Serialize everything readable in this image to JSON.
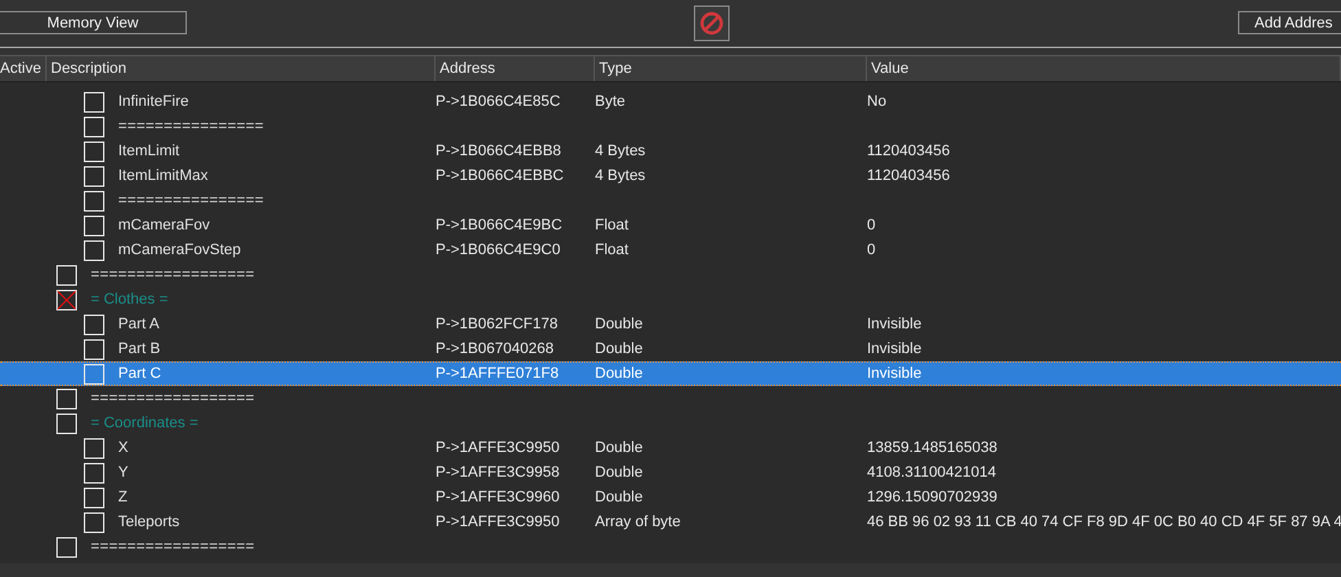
{
  "toolbar": {
    "memory_view_button": "Memory View",
    "add_address_button": "Add Addres"
  },
  "table": {
    "columns": [
      "Active",
      "Description",
      "Address",
      "Type",
      "Value"
    ],
    "rows": [
      {
        "kind": "continuation",
        "children": [
          {
            "kind": "entry",
            "description": "InfiniteFire",
            "address": "P->1B066C4E85C",
            "type": "Byte",
            "value": "No",
            "checked": false,
            "selected": false
          },
          {
            "kind": "separator",
            "description": "================",
            "checked": false,
            "selected": false
          },
          {
            "kind": "entry",
            "description": "ItemLimit",
            "address": "P->1B066C4EBB8",
            "type": "4 Bytes",
            "value": "1120403456",
            "checked": false,
            "selected": false
          },
          {
            "kind": "entry",
            "description": "ItemLimitMax",
            "address": "P->1B066C4EBBC",
            "type": "4 Bytes",
            "value": "1120403456",
            "checked": false,
            "selected": false
          },
          {
            "kind": "separator",
            "description": "================",
            "checked": false,
            "selected": false
          },
          {
            "kind": "entry",
            "description": "mCameraFov",
            "address": "P->1B066C4E9BC",
            "type": "Float",
            "value": "0",
            "checked": false,
            "selected": false
          },
          {
            "kind": "entry",
            "description": "mCameraFovStep",
            "address": "P->1B066C4E9C0",
            "type": "Float",
            "value": "0",
            "checked": false,
            "selected": false
          }
        ]
      },
      {
        "kind": "separator",
        "description": "==================",
        "checked": false,
        "selected": false
      },
      {
        "kind": "group",
        "description": "= Clothes =",
        "checked": true,
        "selected": false,
        "children": [
          {
            "kind": "entry",
            "description": "Part A",
            "address": "P->1B062FCF178",
            "type": "Double",
            "value": "Invisible",
            "checked": false,
            "selected": false
          },
          {
            "kind": "entry",
            "description": "Part B",
            "address": "P->1B067040268",
            "type": "Double",
            "value": "Invisible",
            "checked": false,
            "selected": false
          },
          {
            "kind": "entry",
            "description": "Part C",
            "address": "P->1AFFFE071F8",
            "type": "Double",
            "value": "Invisible",
            "checked": false,
            "selected": true
          }
        ]
      },
      {
        "kind": "separator",
        "description": "==================",
        "checked": false,
        "selected": false
      },
      {
        "kind": "group",
        "description": "= Coordinates =",
        "checked": false,
        "selected": false,
        "children": [
          {
            "kind": "entry",
            "description": "X",
            "address": "P->1AFFE3C9950",
            "type": "Double",
            "value": "13859.1485165038",
            "checked": false,
            "selected": false
          },
          {
            "kind": "entry",
            "description": "Y",
            "address": "P->1AFFE3C9958",
            "type": "Double",
            "value": "4108.31100421014",
            "checked": false,
            "selected": false
          },
          {
            "kind": "entry",
            "description": "Z",
            "address": "P->1AFFE3C9960",
            "type": "Double",
            "value": "1296.15090702939",
            "checked": false,
            "selected": false
          },
          {
            "kind": "entry",
            "description": "Teleports",
            "address": "P->1AFFE3C9950",
            "type": "Array of byte",
            "value": "46 BB 96 02 93 11 CB 40 74 CF F8 9D 4F 0C B0 40 CD 4F 5F 87 9A 4",
            "checked": false,
            "selected": false
          }
        ]
      },
      {
        "kind": "separator",
        "description": "==================",
        "checked": false,
        "selected": false
      }
    ]
  }
}
